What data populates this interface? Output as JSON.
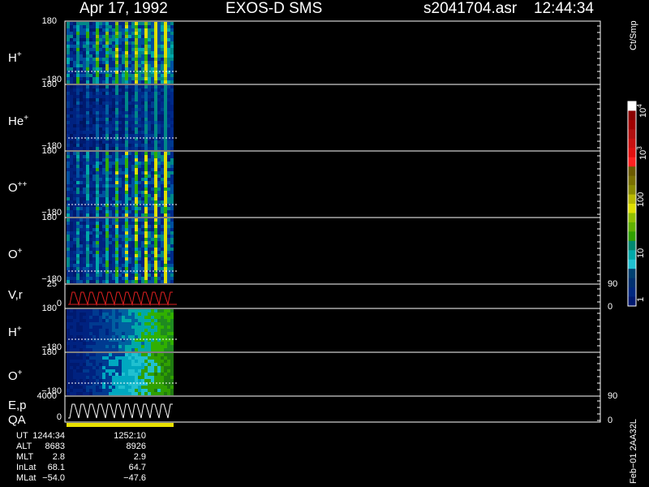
{
  "header": {
    "date": "Apr 17, 1992",
    "instrument": "EXOS-D SMS",
    "file": "s2041704.asr",
    "time": "12:44:34"
  },
  "panels": [
    {
      "name": "H",
      "sup": "+",
      "top": "180",
      "bottom": "−180",
      "kind": "spectrogram",
      "palette": "bright"
    },
    {
      "name": "He",
      "sup": "+",
      "top": "180",
      "bottom": "−180",
      "kind": "spectrogram",
      "palette": "dim"
    },
    {
      "name": "O",
      "sup": "++",
      "top": "180",
      "bottom": "−180",
      "kind": "spectrogram",
      "palette": "mid"
    },
    {
      "name": "O",
      "sup": "+",
      "top": "180",
      "bottom": "−180",
      "kind": "spectrogram",
      "palette": "mid"
    },
    {
      "name": "V,r",
      "sup": "",
      "top": "25",
      "bottom": "0",
      "right_top": "90",
      "right_bottom": "0",
      "kind": "line",
      "color": "#e02020"
    },
    {
      "name": "H",
      "sup": "+",
      "top": "180",
      "bottom": "−180",
      "kind": "spectrogram",
      "palette": "energy_h"
    },
    {
      "name": "O",
      "sup": "+",
      "top": "180",
      "bottom": "−180",
      "kind": "spectrogram",
      "palette": "energy_o"
    },
    {
      "name": "E,p",
      "sup": "",
      "top": "4000",
      "bottom": "0",
      "right_top": "90",
      "right_bottom": "0",
      "kind": "line",
      "color": "#ffffff"
    }
  ],
  "qa_label": "QA",
  "colorbar": {
    "title": "Ct/Smp",
    "ticks": [
      {
        "base": "10",
        "exp": "4"
      },
      {
        "base": "10",
        "exp": "3"
      },
      {
        "base": "100",
        "exp": ""
      },
      {
        "base": "10",
        "exp": ""
      },
      {
        "base": "1",
        "exp": ""
      }
    ],
    "colors": [
      "#ffffff",
      "#8b0000",
      "#a00000",
      "#b01010",
      "#c81010",
      "#e01010",
      "#ff2020",
      "#6b5a00",
      "#7a7000",
      "#8a8a00",
      "#b8b800",
      "#e0e000",
      "#90c000",
      "#60b000",
      "#30a000",
      "#008870",
      "#00a8a8",
      "#20c0d0",
      "#004070",
      "#003070",
      "#002880",
      "#001a70"
    ]
  },
  "orbit": {
    "rows": [
      {
        "name": "UT",
        "v1": "1244:34",
        "v2": "1252:10"
      },
      {
        "name": "ALT",
        "v1": "8683",
        "v2": "8926"
      },
      {
        "name": "MLT",
        "v1": "2.8",
        "v2": "2.9"
      },
      {
        "name": "InLat",
        "v1": "68.1",
        "v2": "64.7"
      },
      {
        "name": "MLat",
        "v1": "−54.0",
        "v2": "−47.6"
      }
    ]
  },
  "side_label": "Feb−01 2AA32L",
  "chart_data": {
    "type": "heatmap",
    "title": "Apr 17, 1992 EXOS-D SMS",
    "xlabel": "UT",
    "x_ticks": [
      "1244:34",
      "1252:10"
    ],
    "color_scale": "log",
    "color_range": [
      1,
      10000
    ],
    "color_unit": "Ct/Smp",
    "series": [
      {
        "name": "H+",
        "ylim": [
          -180,
          180
        ]
      },
      {
        "name": "He+",
        "ylim": [
          -180,
          180
        ]
      },
      {
        "name": "O++",
        "ylim": [
          -180,
          180
        ]
      },
      {
        "name": "O+",
        "ylim": [
          -180,
          180
        ]
      },
      {
        "name": "V,r",
        "ylim": [
          0,
          25
        ]
      },
      {
        "name": "H+",
        "ylim": [
          -180,
          180
        ]
      },
      {
        "name": "O+",
        "ylim": [
          -180,
          180
        ]
      },
      {
        "name": "E,p",
        "ylim": [
          0,
          4000
        ]
      }
    ]
  }
}
